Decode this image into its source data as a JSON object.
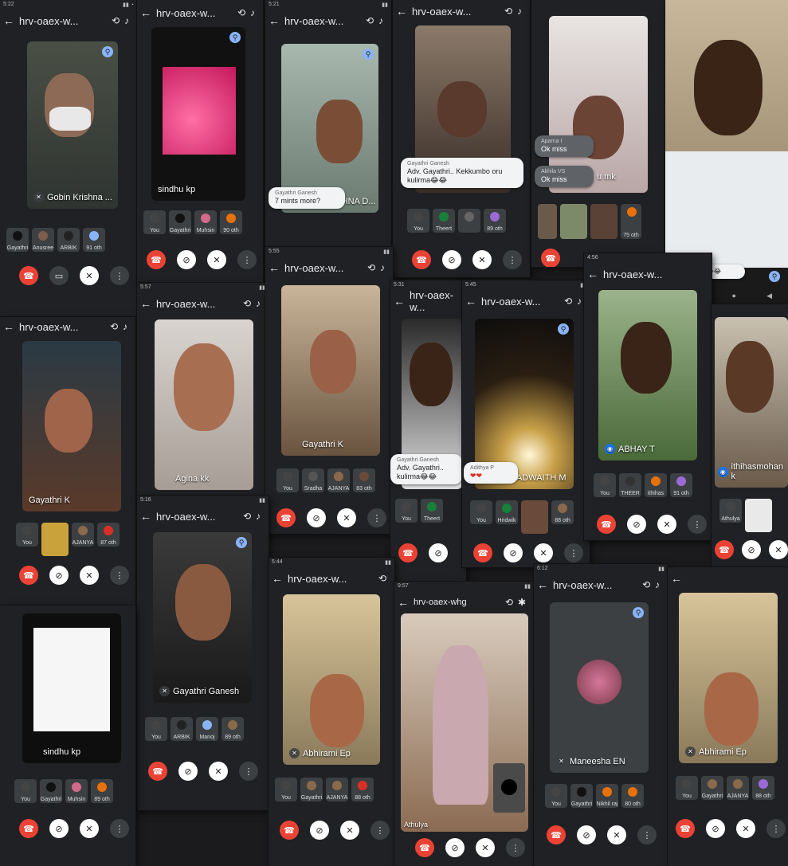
{
  "meeting_code": "hrv-oaex-w...",
  "meeting_code_alt": "hrv-oaex-whg",
  "clocks": [
    "5:22",
    "5:21",
    "5:55",
    "5:57",
    "5:31",
    "5:45",
    "4:56",
    "5:16",
    "5:44",
    "6:12"
  ],
  "cards": {
    "c1": {
      "name": "Gobin Krishna ...",
      "tiles": [
        "Gayathri",
        "Anusree",
        "ARBIK",
        "91 oth"
      ]
    },
    "c2": {
      "name": "sindhu kp"
    },
    "c3": {
      "name": "KRISHNA D...",
      "chat_sender": "Gayathri Ganesh",
      "chat_text": "7 mints more?"
    },
    "c4": {
      "chat_sender": "Gayathri Ganesh",
      "chat_text": "Adv. Gayathri.. Kekkumbo oru kulirma😂😂",
      "tiles": [
        "You",
        "Theert",
        "",
        "89 oth"
      ]
    },
    "c5": {
      "name": "u mk",
      "chat1_sender": "Aparna I",
      "chat1_text": "Ok miss",
      "chat2_sender": "Akhila VS",
      "chat2_text": "Ok miss",
      "tiles": [
        "75 oth"
      ]
    },
    "c6": {
      "chat_text": "😂😂😂😂😂😂"
    },
    "c7": {
      "name": "Gayathri K",
      "tiles": [
        "You",
        "",
        "AJANYA",
        "87 oth"
      ]
    },
    "c8": {
      "name": "Agina kk"
    },
    "c9": {
      "name": "Gayathri K",
      "tiles": [
        "You",
        "Sradha",
        "AJANYA",
        "83 oth"
      ]
    },
    "c10": {
      "chat_sender": "Gayathri Ganesh",
      "chat_text": "Adv. Gayathri.. kulirma😂😂",
      "tiles": [
        "You",
        "Theert"
      ]
    },
    "c11": {
      "name": "ADWAITH M",
      "chat_sender": "Adithya P",
      "chat_text": "❤❤",
      "tiles": [
        "You",
        "Hridwik",
        "",
        "88 oth"
      ]
    },
    "c12": {
      "name": "ABHAY T",
      "tiles": [
        "You",
        "THEER",
        "ithihas",
        "91 oth"
      ]
    },
    "c13": {
      "name": "ithihasmohan k",
      "tiles": [
        "Athulya",
        ""
      ]
    },
    "c14": {
      "name": "Gayathri Ganesh",
      "tiles": [
        "You",
        "ARBIK",
        "Manoj",
        "89 oth"
      ]
    },
    "c15": {
      "name": "sindhu kp",
      "tiles": [
        "You",
        "Gayathri",
        "Muhsin",
        "89 oth"
      ]
    },
    "c16": {
      "name": "Abhirami Ep",
      "tiles": [
        "You",
        "Gayathri",
        "AJANYA",
        "88 oth"
      ]
    },
    "c17": {
      "name": "Athulya"
    },
    "c18": {
      "name": "Maneesha EN",
      "tiles": [
        "You",
        "Gayathri",
        "Nikhil raj",
        "80 oth"
      ]
    },
    "c19": {
      "name": "Abhirami Ep",
      "tiles": [
        "You",
        "Gayathri",
        "AJANYA",
        "88 oth"
      ]
    },
    "c2b": {
      "tiles": [
        "You",
        "Gayathri",
        "Muhsin",
        "90 oth"
      ]
    }
  },
  "colors": {
    "end_call": "#ea4335",
    "pin": "#8ab4f8",
    "bg": "#202124"
  }
}
